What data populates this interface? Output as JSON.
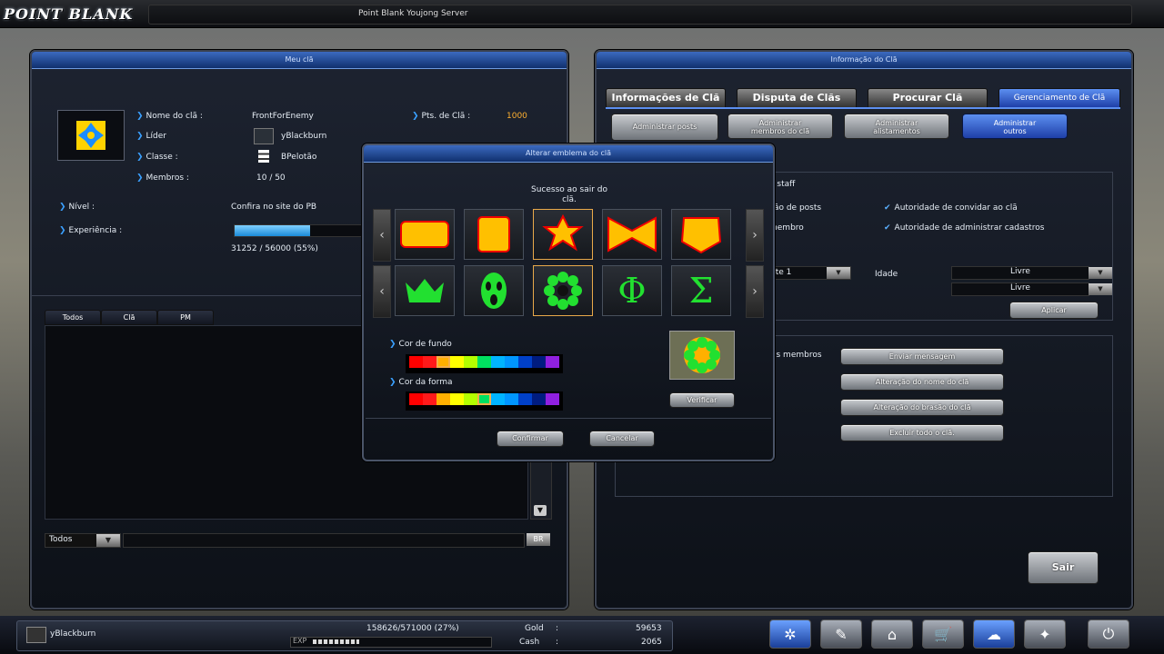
{
  "app": {
    "logo": "POINT BLANK",
    "server": "Point Blank Youjong Server"
  },
  "left_panel": {
    "title": "Meu clã",
    "clan_name_label": "Nome do clã :",
    "clan_name": "FrontForEnemy",
    "points_label": "Pts. de Clã :",
    "points": "1000",
    "leader_label": "Líder",
    "leader": "yBlackburn",
    "class_label": "Classe :",
    "class": "BPelotão",
    "members_label": "Membros :",
    "members": "10 / 50",
    "level_label": "Nível :",
    "level": "Confira no site do PB",
    "exp_label": "Experiência :",
    "exp_value": "31252 / 56000 (55%)",
    "exp_percent": 55,
    "chat_tabs": [
      "Todos",
      "Clã",
      "PM"
    ],
    "chat_filter": "Todos",
    "chat_lang": "BR"
  },
  "right_panel": {
    "title": "Informação do Clã",
    "tabs": [
      "Informações de Clã",
      "Disputa de Clãs",
      "Procurar Clã",
      "Gerenciamento de Clã"
    ],
    "subtabs": [
      {
        "line1": "Administrar posts",
        "line2": ""
      },
      {
        "line1": "Administrar",
        "line2": "membros do clã"
      },
      {
        "line1": "Administrar",
        "line2": "alistamentos"
      },
      {
        "line1": "Administrar",
        "line2": "outros"
      }
    ],
    "staff_header": "e staff",
    "perm_posts": "ção de posts",
    "perm_invite": "Autoridade de convidar ao clã",
    "perm_member": "membro",
    "perm_register": "Autoridade de administrar cadastros",
    "perm_o": "o",
    "rank_value": "nte 1",
    "age_label": "Idade",
    "age_value1": "Livre",
    "age_value2": "Livre",
    "apply": "Aplicar",
    "members_label": "os membros",
    "actions": [
      "Enviar mensagem",
      "Alteração do nome do clã",
      "Alteração do brasão do clã",
      "Excluir todo o clã."
    ],
    "exit": "Sair"
  },
  "dialog": {
    "title": "Alterar emblema do clã",
    "tooltip": "Sucesso ao sair do clã.",
    "emblem_row1": [
      "rectangle",
      "square",
      "star",
      "bowtie",
      "shield"
    ],
    "emblem_row2": [
      "crown",
      "mask",
      "flower",
      "Φ",
      "Σ"
    ],
    "bg_color_label": "Cor de fundo",
    "shape_color_label": "Cor da forma",
    "colors": [
      "#ff0000",
      "#ff1a1a",
      "#ffb000",
      "#ffff00",
      "#b4ff00",
      "#00e060",
      "#00b4ff",
      "#0096ff",
      "#0040c8",
      "#001c80",
      "#9020e0"
    ],
    "selected_bg": 2,
    "selected_shape": 5,
    "verify": "Verificar",
    "confirm": "Confirmar",
    "cancel": "Cancelar"
  },
  "status": {
    "player": "yBlackburn",
    "exp": "158626/571000 (27%)",
    "exp_tag": "EXP",
    "gold_label": "Gold",
    "gold": "59653",
    "cash_label": "Cash",
    "cash": "2065"
  }
}
